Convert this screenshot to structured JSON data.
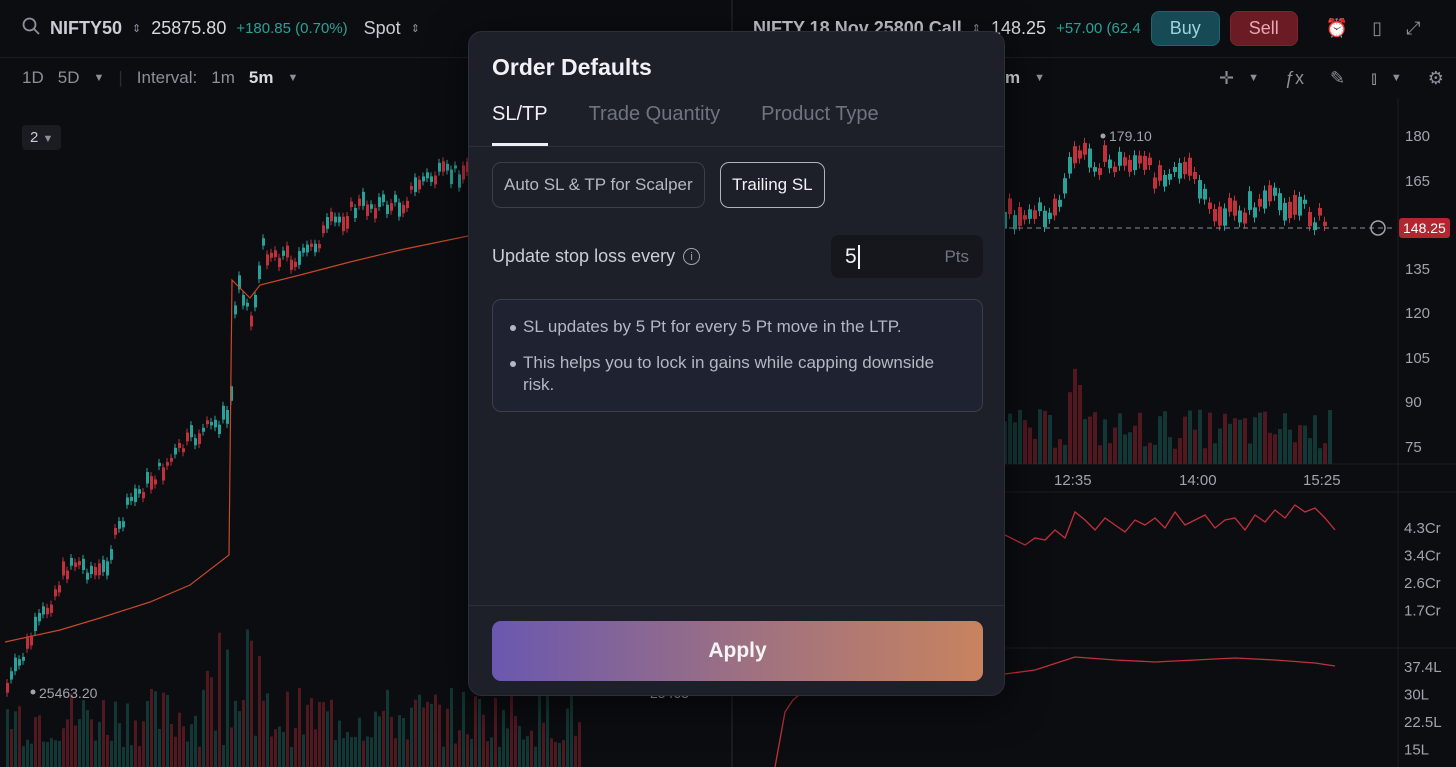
{
  "left_chart": {
    "symbol": "NIFTY50",
    "price": "25875.80",
    "change": "+180.85 (0.70%)",
    "spot_label": "Spot",
    "range_1d": "1D",
    "range_5d": "5D",
    "interval_label": "Interval:",
    "interval_1m": "1m",
    "interval_5m": "5m",
    "pane_selector": "2",
    "low_marker": "25463.20",
    "axis_partial": "25463"
  },
  "right_chart": {
    "symbol": "NIFTY 18 Nov 25800 Call",
    "price": "148.25",
    "change": "+57.00 (62.4",
    "buy_label": "Buy",
    "sell_label": "Sell",
    "interval_partial": "m",
    "high_marker": "179.10",
    "last_price_badge": "148.25",
    "y_ticks": [
      "180",
      "165",
      "135",
      "120",
      "105",
      "90",
      "75"
    ],
    "x_ticks": [
      "12:35",
      "14:00",
      "15:25"
    ],
    "oi_ticks": [
      "4.3Cr",
      "3.4Cr",
      "2.6Cr",
      "1.7Cr"
    ],
    "vol_ticks": [
      "37.4L",
      "30L",
      "22.5L",
      "15L"
    ],
    "colors": {
      "up": "#2aa198",
      "down": "#c2303c",
      "badge": "#b3262f"
    }
  },
  "modal": {
    "title": "Order Defaults",
    "tabs": [
      {
        "label": "SL/TP",
        "active": true
      },
      {
        "label": "Trade Quantity",
        "active": false
      },
      {
        "label": "Product Type",
        "active": false
      }
    ],
    "options": [
      {
        "label": "Auto SL & TP for Scalper",
        "selected": false
      },
      {
        "label": "Trailing SL",
        "selected": true
      }
    ],
    "update_label": "Update stop loss every",
    "input_value": "5",
    "input_unit": "Pts",
    "notes": [
      "SL updates by 5 Pt for every 5 Pt move in the LTP.",
      "This helps you to lock in gains while capping downside risk."
    ],
    "apply_label": "Apply",
    "colors": {
      "apply_start": "#6a58b0",
      "apply_end": "#c8835f"
    }
  }
}
